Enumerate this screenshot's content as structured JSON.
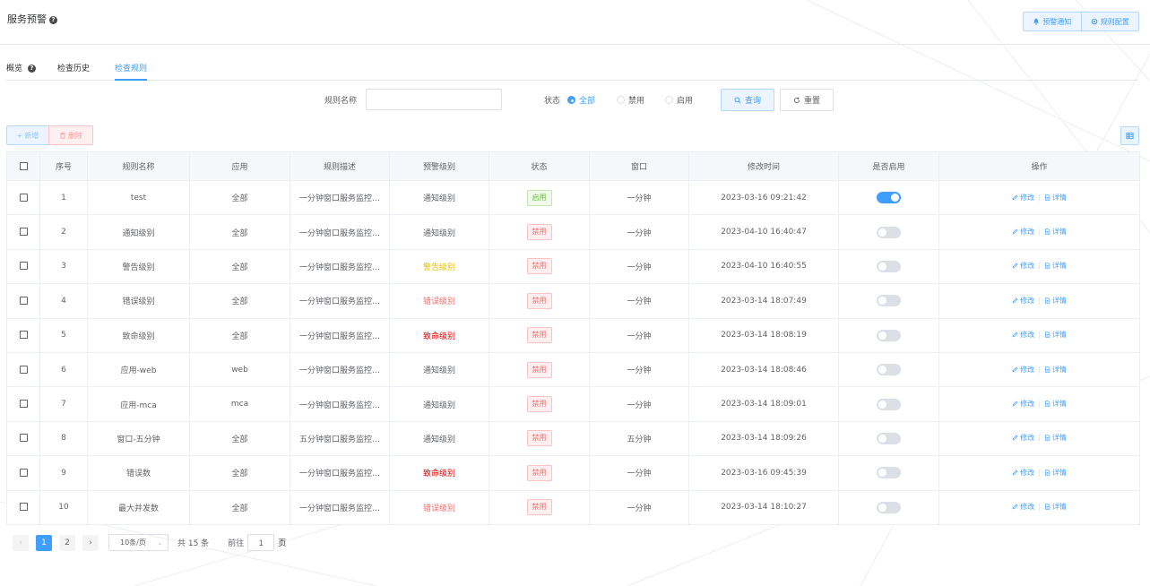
{
  "header": {
    "title": "服务预警",
    "help_mark": "?",
    "btn_notify": "预警通知",
    "btn_config": "规则配置"
  },
  "tabs": [
    {
      "label": "概览",
      "help": "?"
    },
    {
      "label": "检查历史"
    },
    {
      "label": "检查规则"
    }
  ],
  "filter": {
    "name_label": "规则名称",
    "name_value": "",
    "name_placeholder": "",
    "status_label": "状态",
    "status_options": [
      "全部",
      "禁用",
      "启用"
    ],
    "status_selected": "全部",
    "query_label": "查询",
    "reset_label": "重置"
  },
  "actions": {
    "add_label": "新增",
    "delete_label": "删除"
  },
  "table": {
    "columns": [
      "序号",
      "规则名称",
      "应用",
      "规则描述",
      "预警级别",
      "状态",
      "窗口",
      "修改时间",
      "是否启用",
      "操作"
    ],
    "edit_label": "修改",
    "detail_label": "详情",
    "rows": [
      {
        "no": "1",
        "name": "test",
        "app": "全部",
        "desc": "一分钟窗口服务监控…",
        "level": "通知级别",
        "level_color": "#606266",
        "status": "启用",
        "window": "一分钟",
        "time": "2023-03-16 09:21:42",
        "enabled": true
      },
      {
        "no": "2",
        "name": "通知级别",
        "app": "全部",
        "desc": "一分钟窗口服务监控…",
        "level": "通知级别",
        "level_color": "#606266",
        "status": "禁用",
        "window": "一分钟",
        "time": "2023-04-10 16:40:47",
        "enabled": false
      },
      {
        "no": "3",
        "name": "警告级别",
        "app": "全部",
        "desc": "一分钟窗口服务监控…",
        "level": "警告级别",
        "level_color": "#e6c000",
        "status": "禁用",
        "window": "一分钟",
        "time": "2023-04-10 16:40:55",
        "enabled": false
      },
      {
        "no": "4",
        "name": "错误级别",
        "app": "全部",
        "desc": "一分钟窗口服务监控…",
        "level": "错误级别",
        "level_color": "#f56c6c",
        "status": "禁用",
        "window": "一分钟",
        "time": "2023-03-14 18:07:49",
        "enabled": false
      },
      {
        "no": "5",
        "name": "致命级别",
        "app": "全部",
        "desc": "一分钟窗口服务监控…",
        "level": "致命级别",
        "level_color": "#e00000",
        "status": "禁用",
        "window": "一分钟",
        "time": "2023-03-14 18:08:19",
        "enabled": false
      },
      {
        "no": "6",
        "name": "应用-web",
        "app": "web",
        "desc": "一分钟窗口服务监控…",
        "level": "通知级别",
        "level_color": "#606266",
        "status": "禁用",
        "window": "一分钟",
        "time": "2023-03-14 18:08:46",
        "enabled": false
      },
      {
        "no": "7",
        "name": "应用-mca",
        "app": "mca",
        "desc": "一分钟窗口服务监控…",
        "level": "通知级别",
        "level_color": "#606266",
        "status": "禁用",
        "window": "一分钟",
        "time": "2023-03-14 18:09:01",
        "enabled": false
      },
      {
        "no": "8",
        "name": "窗口-五分钟",
        "app": "全部",
        "desc": "五分钟窗口服务监控…",
        "level": "通知级别",
        "level_color": "#606266",
        "status": "禁用",
        "window": "五分钟",
        "time": "2023-03-14 18:09:26",
        "enabled": false
      },
      {
        "no": "9",
        "name": "错误数",
        "app": "全部",
        "desc": "一分钟窗口服务监控…",
        "level": "致命级别",
        "level_color": "#e00000",
        "status": "禁用",
        "window": "一分钟",
        "time": "2023-03-16 09:45:39",
        "enabled": false
      },
      {
        "no": "10",
        "name": "最大并发数",
        "app": "全部",
        "desc": "一分钟窗口服务监控…",
        "level": "错误级别",
        "level_color": "#f56c6c",
        "status": "禁用",
        "window": "一分钟",
        "time": "2023-03-14 18:10:27",
        "enabled": false
      }
    ]
  },
  "pagination": {
    "prev": "‹",
    "next": "›",
    "pages": [
      "1",
      "2"
    ],
    "current": "1",
    "page_size": "10条/页",
    "total": "共 15 条",
    "goto_prefix": "前往",
    "goto_value": "1",
    "goto_suffix": "页"
  },
  "colors": {
    "primary": "#409eff",
    "success": "#67c23a",
    "danger": "#f56c6c",
    "warning": "#e6c000"
  }
}
